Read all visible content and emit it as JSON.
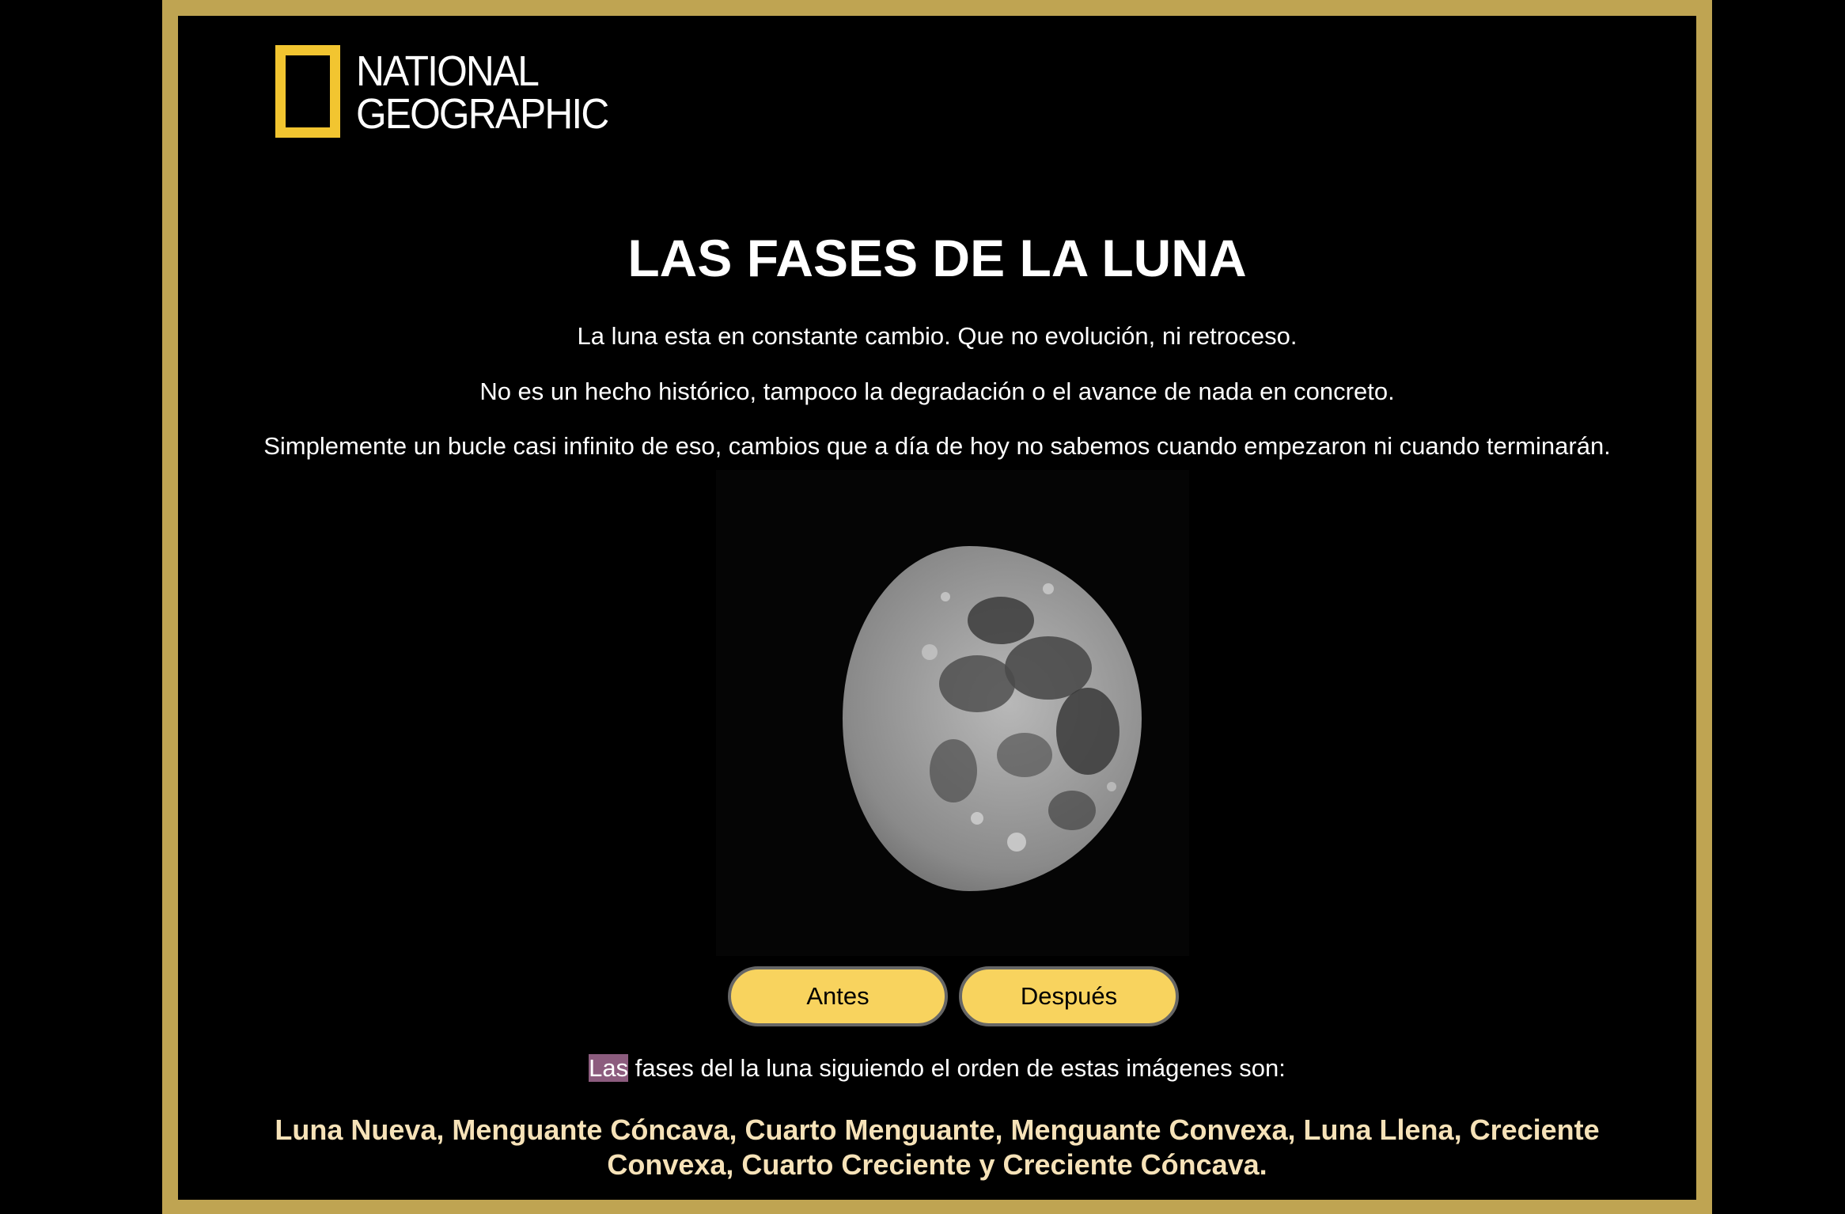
{
  "logo": {
    "line1": "NATIONAL",
    "line2": "GEOGRAPHIC",
    "border_color": "#f2c530"
  },
  "header": {
    "title": "LAS FASES DE LA LUNA"
  },
  "intro": {
    "line1": "La luna esta en constante cambio. Que no evolución, ni retroceso.",
    "line2": "No es un hecho histórico, tampoco la degradación o el avance de nada en concreto.",
    "line3": "Simplemente un bucle casi infinito de eso, cambios que a día de hoy no sabemos cuando empezaron ni cuando terminarán."
  },
  "image": {
    "subject": "moon-phase-gibbous-image"
  },
  "buttons": {
    "prev_label": "Antes",
    "next_label": "Después"
  },
  "phases": {
    "intro_highlight": "Las",
    "intro_rest": " fases del la luna siguiendo el orden de estas imágenes son:",
    "list": "Luna Nueva, Menguante Cóncava, Cuarto Menguante, Menguante Convexa, Luna Llena, Creciente Convexa, Cuarto Creciente y Creciente Cóncava."
  },
  "colors": {
    "frame": "#bfa452",
    "button": "#f8d35e",
    "phases_text": "#f6e2b8",
    "selection": "#8c5c7e"
  }
}
